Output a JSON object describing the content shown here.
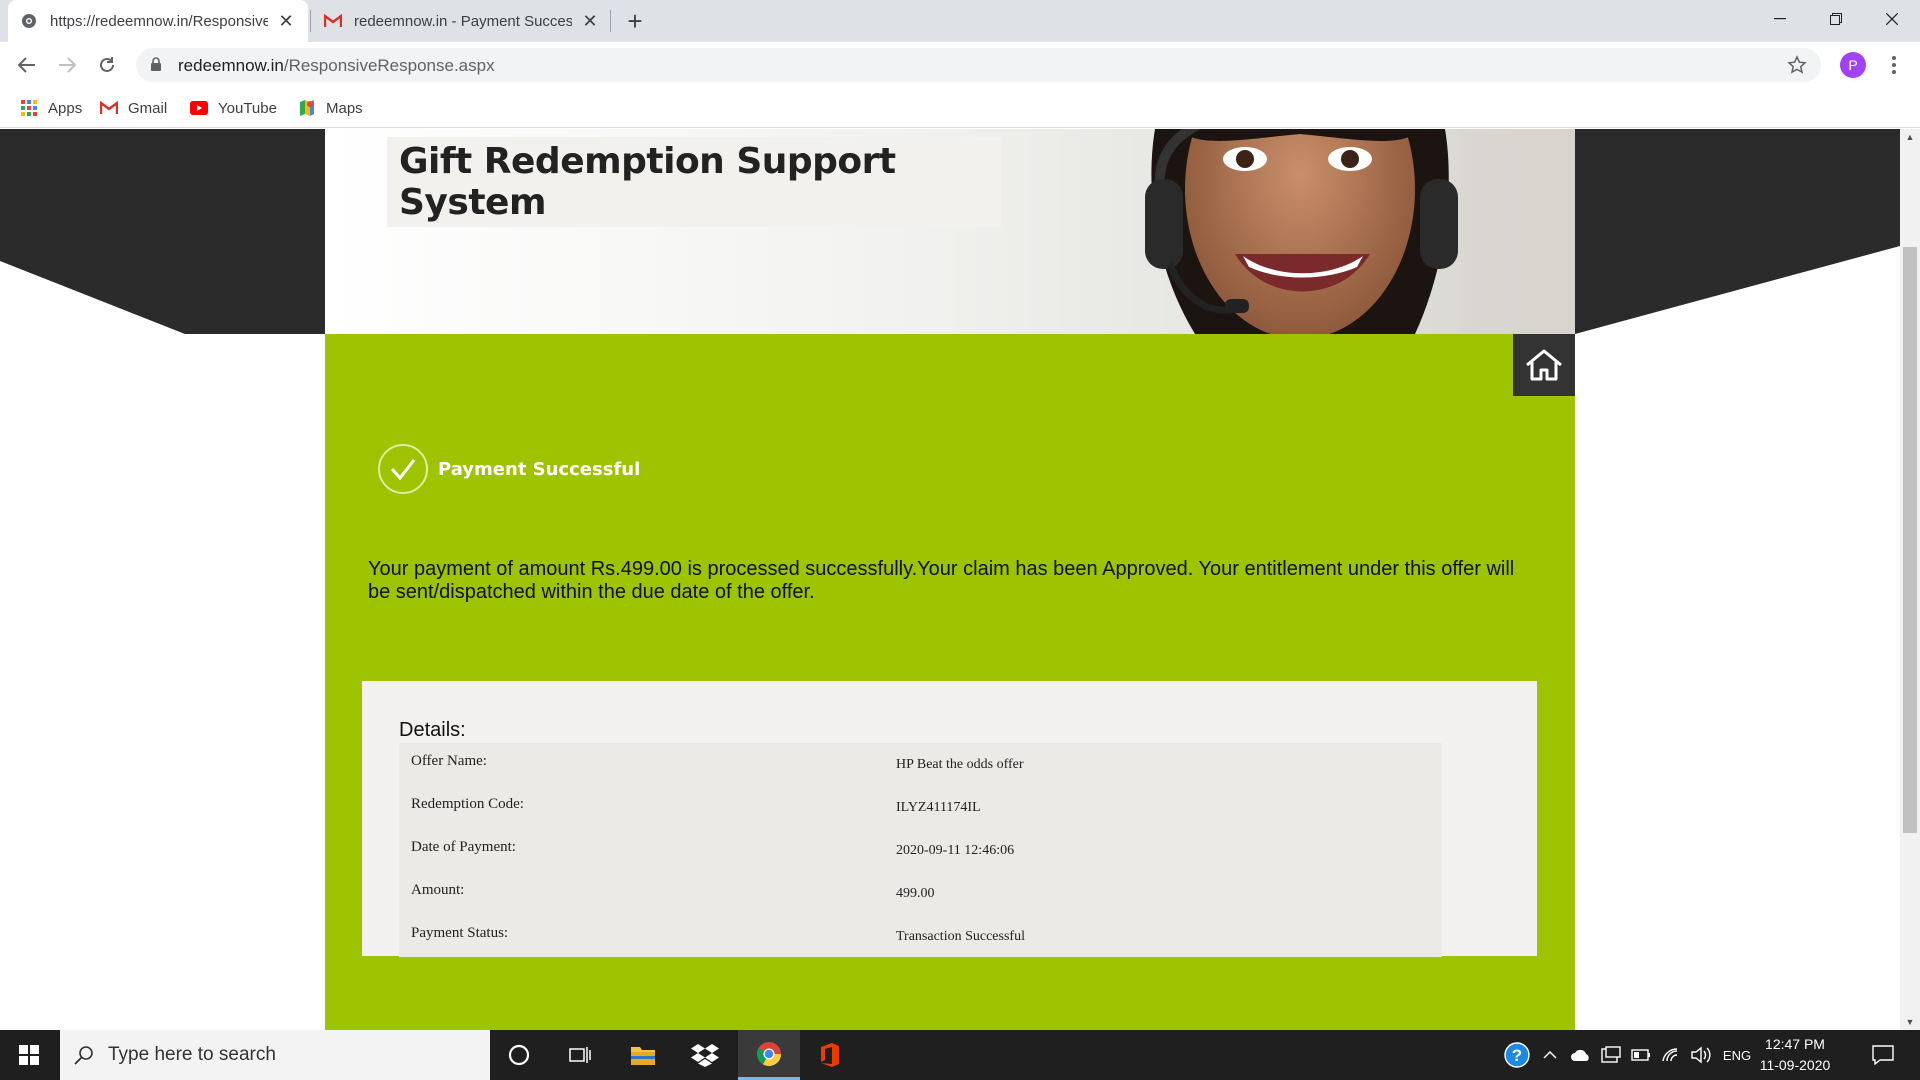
{
  "browser": {
    "tabs": [
      {
        "title": "https://redeemnow.in/ResponsiveResponse.aspx",
        "active": true
      },
      {
        "title": "redeemnow.in - Payment Successful",
        "active": false
      }
    ],
    "url_host": "redeemnow.in",
    "url_path": "/ResponsiveResponse.aspx",
    "profile_initial": "P",
    "bookmarks": [
      "Apps",
      "Gmail",
      "YouTube",
      "Maps"
    ]
  },
  "page": {
    "site_title": "Gift Redemption Support System",
    "status_label": "Payment Successful",
    "message": "Your payment of amount Rs.499.00 is processed successfully.Your claim has been Approved. Your entitlement under this offer will be sent/dispatched within the due date of the offer.",
    "details_heading": "Details:",
    "details": [
      {
        "label": "Offer Name:",
        "value": "HP Beat the odds offer"
      },
      {
        "label": "Redemption Code:",
        "value": "ILYZ411174IL"
      },
      {
        "label": "Date of Payment:",
        "value": "2020-09-11 12:46:06"
      },
      {
        "label": "Amount:",
        "value": "499.00"
      },
      {
        "label": "Payment Status:",
        "value": "Transaction Successful"
      }
    ],
    "colors": {
      "green": "#9ec300",
      "dark_band": "#2b2b2b",
      "home_button": "#333333"
    }
  },
  "taskbar": {
    "search_placeholder": "Type here to search",
    "language": "ENG",
    "time": "12:47 PM",
    "date": "11-09-2020"
  }
}
